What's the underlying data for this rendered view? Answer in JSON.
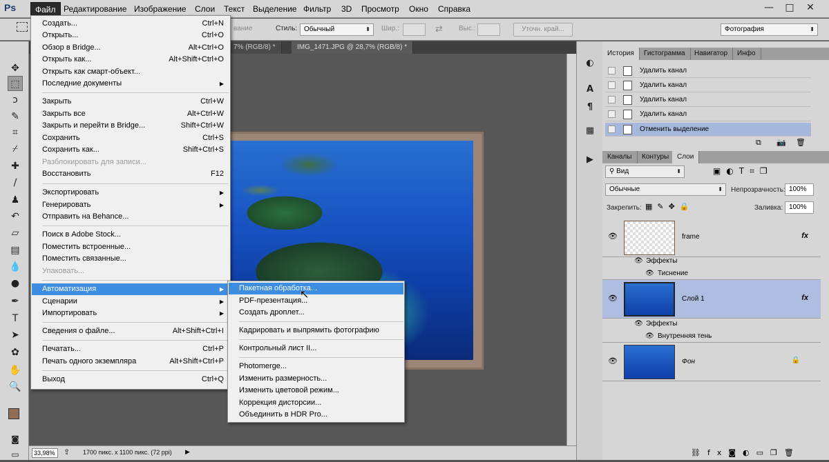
{
  "app": {
    "logo": "Ps"
  },
  "menubar": [
    "Файл",
    "Редактирование",
    "Изображение",
    "Слои",
    "Текст",
    "Выделение",
    "Фильтр",
    "3D",
    "Просмотр",
    "Окно",
    "Справка"
  ],
  "window_controls": {
    "minimize": "—",
    "maximize": "□",
    "close": "✕"
  },
  "options": {
    "style_label": "Стиль:",
    "style_value": "Обычный",
    "width_label": "Шир.:",
    "height_label": "Выс.:",
    "refine_label": "Уточн. край...",
    "antialias_label": "вание",
    "workspace": "Фотография"
  },
  "doc_tabs": [
    "7% (RGB/8) *",
    "IMG_1471.JPG @ 28,7% (RGB/8) *"
  ],
  "file_menu": [
    {
      "label": "Создать...",
      "shortcut": "Ctrl+N"
    },
    {
      "label": "Открыть...",
      "shortcut": "Ctrl+O"
    },
    {
      "label": "Обзор в Bridge...",
      "shortcut": "Alt+Ctrl+O"
    },
    {
      "label": "Открыть как...",
      "shortcut": "Alt+Shift+Ctrl+O"
    },
    {
      "label": "Открыть как смарт-объект...",
      "shortcut": ""
    },
    {
      "label": "Последние документы",
      "shortcut": "",
      "submenu": true
    },
    {
      "label": "Закрыть",
      "shortcut": "Ctrl+W"
    },
    {
      "label": "Закрыть все",
      "shortcut": "Alt+Ctrl+W"
    },
    {
      "label": "Закрыть и перейти в Bridge...",
      "shortcut": "Shift+Ctrl+W"
    },
    {
      "label": "Сохранить",
      "shortcut": "Ctrl+S"
    },
    {
      "label": "Сохранить как...",
      "shortcut": "Shift+Ctrl+S"
    },
    {
      "label": "Разблокировать для записи...",
      "shortcut": "",
      "disabled": true
    },
    {
      "label": "Восстановить",
      "shortcut": "F12"
    },
    {
      "label": "Экспортировать",
      "shortcut": "",
      "submenu": true
    },
    {
      "label": "Генерировать",
      "shortcut": "",
      "submenu": true
    },
    {
      "label": "Отправить на Behance...",
      "shortcut": ""
    },
    {
      "label": "Поиск в Adobe Stock...",
      "shortcut": ""
    },
    {
      "label": "Поместить встроенные...",
      "shortcut": ""
    },
    {
      "label": "Поместить связанные...",
      "shortcut": ""
    },
    {
      "label": "Упаковать...",
      "shortcut": "",
      "disabled": true
    },
    {
      "label": "Автоматизация",
      "shortcut": "",
      "submenu": true,
      "highlight": true
    },
    {
      "label": "Сценарии",
      "shortcut": "",
      "submenu": true
    },
    {
      "label": "Импортировать",
      "shortcut": "",
      "submenu": true
    },
    {
      "label": "Сведения о файле...",
      "shortcut": "Alt+Shift+Ctrl+I"
    },
    {
      "label": "Печатать...",
      "shortcut": "Ctrl+P"
    },
    {
      "label": "Печать одного экземпляра",
      "shortcut": "Alt+Shift+Ctrl+P"
    },
    {
      "label": "Выход",
      "shortcut": "Ctrl+Q"
    }
  ],
  "auto_menu": [
    {
      "label": "Пакетная обработка...",
      "highlight": true
    },
    {
      "label": "PDF-презентация..."
    },
    {
      "label": "Создать дроплет..."
    },
    {
      "label": "Кадрировать и выпрямить фотографию"
    },
    {
      "label": "Контрольный лист II..."
    },
    {
      "label": "Photomerge..."
    },
    {
      "label": "Изменить размерность..."
    },
    {
      "label": "Изменить цветовой режим..."
    },
    {
      "label": "Коррекция дисторсии..."
    },
    {
      "label": "Объединить в HDR Pro..."
    }
  ],
  "history_tabs": [
    "История",
    "Гистограмма",
    "Навигатор",
    "Инфо"
  ],
  "history": [
    "Удалить канал",
    "Удалить канал",
    "Удалить канал",
    "Удалить канал",
    "Отменить выделение"
  ],
  "layers_tabs": [
    "Каналы",
    "Контуры",
    "Слои"
  ],
  "layers_panel": {
    "filter_label": "Вид",
    "blend_mode": "Обычные",
    "opacity_label": "Непрозрачность:",
    "opacity_value": "100%",
    "lock_label": "Закрепить:",
    "fill_label": "Заливка:",
    "fill_value": "100%"
  },
  "layers": [
    {
      "name": "frame",
      "fx": "fx",
      "effects_label": "Эффекты",
      "effect": "Тиснение"
    },
    {
      "name": "Слой 1",
      "fx": "fx",
      "effects_label": "Эффекты",
      "effect": "Внутренняя тень"
    },
    {
      "name": "Фон",
      "lock": "🔒"
    }
  ],
  "status": {
    "zoom": "33,98%",
    "info": "1700 пикс. x 1100 пикс. (72 ppi)"
  },
  "colors": {
    "menu_highlight": "#3d8de0",
    "foreground": "#8f6e55",
    "background": "#ffffff"
  }
}
